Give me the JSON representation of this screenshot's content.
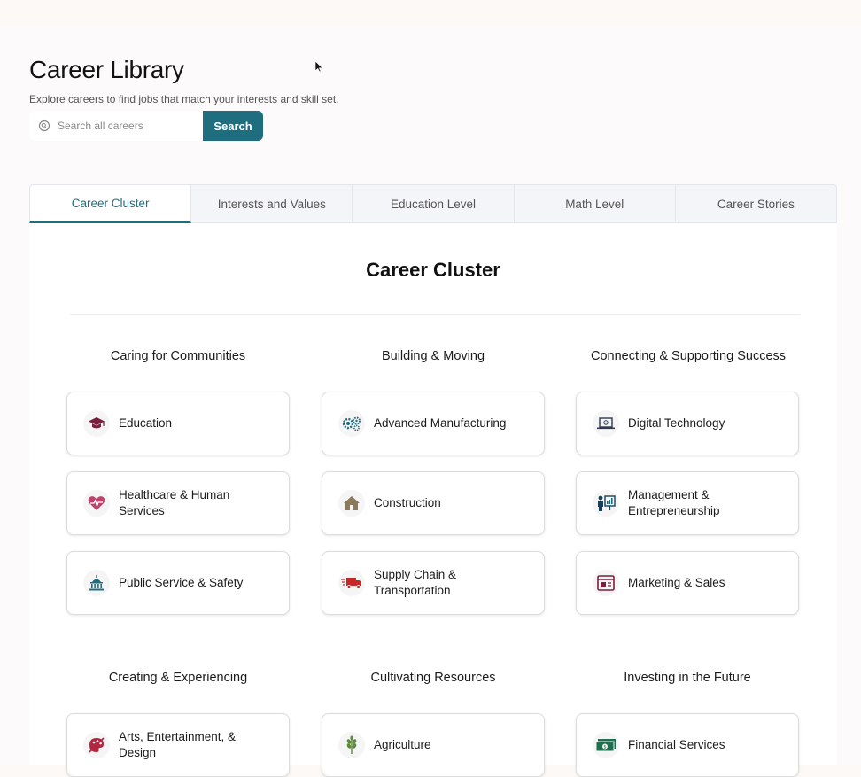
{
  "header": {
    "title": "Career Library",
    "subtitle": "Explore careers to find jobs that match your interests and skill set."
  },
  "search": {
    "placeholder": "Search all careers",
    "button_label": "Search"
  },
  "tabs": [
    {
      "label": "Career Cluster",
      "active": true
    },
    {
      "label": "Interests and Values",
      "active": false
    },
    {
      "label": "Education Level",
      "active": false
    },
    {
      "label": "Math Level",
      "active": false
    },
    {
      "label": "Career Stories",
      "active": false
    }
  ],
  "panel": {
    "title": "Career Cluster"
  },
  "groups": [
    {
      "title": "Caring for Communities",
      "cards": [
        {
          "label": "Education",
          "icon": "graduation-cap-icon"
        },
        {
          "label": "Healthcare & Human Services",
          "icon": "heart-pulse-icon"
        },
        {
          "label": "Public Service & Safety",
          "icon": "capitol-building-icon"
        }
      ]
    },
    {
      "title": "Building & Moving",
      "cards": [
        {
          "label": "Advanced Manufacturing",
          "icon": "gears-icon"
        },
        {
          "label": "Construction",
          "icon": "house-icon"
        },
        {
          "label": "Supply Chain & Transportation",
          "icon": "delivery-truck-icon"
        }
      ]
    },
    {
      "title": "Connecting & Supporting Success",
      "cards": [
        {
          "label": "Digital Technology",
          "icon": "laptop-icon"
        },
        {
          "label": "Management & Entrepreneurship",
          "icon": "presenter-board-icon"
        },
        {
          "label": "Marketing & Sales",
          "icon": "browser-window-icon"
        }
      ]
    },
    {
      "title": "Creating & Experiencing",
      "cards": [
        {
          "label": "Arts, Entertainment, & Design",
          "icon": "palette-icon"
        }
      ]
    },
    {
      "title": "Cultivating Resources",
      "cards": [
        {
          "label": "Agriculture",
          "icon": "wheat-icon"
        }
      ]
    },
    {
      "title": "Investing in the Future",
      "cards": [
        {
          "label": "Financial Services",
          "icon": "money-bill-icon"
        }
      ]
    }
  ],
  "colors": {
    "accent": "#1f6e80",
    "education_icon": "#7a1f3d",
    "healthcare_icon": "#c2416b",
    "public_service_icon": "#1f6e80",
    "manufacturing_icon": "#1f6e80",
    "construction_icon": "#8a7a5a",
    "supply_chain_icon": "#c62828",
    "digital_icon": "#2b3a55",
    "management_icon": "#17405a",
    "marketing_icon": "#7a1f3d",
    "arts_icon": "#b3263f",
    "agriculture_icon": "#5a8a3a",
    "finance_icon": "#1f6e50"
  }
}
